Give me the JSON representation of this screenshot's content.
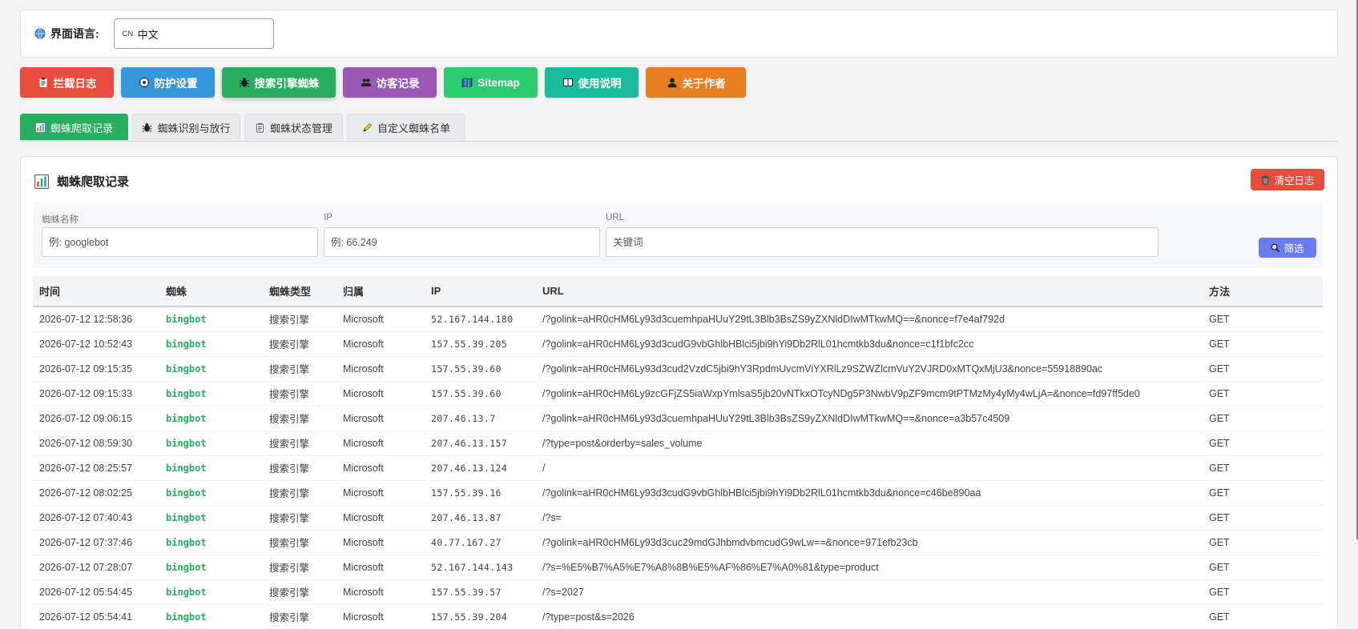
{
  "language": {
    "label": "界面语言:",
    "flag_text": "CN",
    "selected": "中文"
  },
  "main_nav": [
    {
      "label": "拦截日志",
      "icon": "clipboard-icon",
      "color": "#e74c3c"
    },
    {
      "label": "防护设置",
      "icon": "gear-icon",
      "color": "#3498db"
    },
    {
      "label": "搜索引擎蜘蛛",
      "icon": "bug-icon",
      "color": "#27ae60"
    },
    {
      "label": "访客记录",
      "icon": "users-icon",
      "color": "#9b59b6"
    },
    {
      "label": "Sitemap",
      "icon": "map-icon",
      "color": "#2ecc71"
    },
    {
      "label": "使用说明",
      "icon": "book-icon",
      "color": "#1abc9c"
    },
    {
      "label": "关于作者",
      "icon": "user-icon",
      "color": "#e67e22"
    }
  ],
  "sub_tabs": [
    {
      "label": "蜘蛛爬取记录",
      "icon": "bar-chart-icon",
      "active": true
    },
    {
      "label": "蜘蛛识别与放行",
      "icon": "bug-icon",
      "active": false
    },
    {
      "label": "蜘蛛状态管理",
      "icon": "clipboard-icon",
      "active": false
    },
    {
      "label": "自定义蜘蛛名单",
      "icon": "pencil-icon",
      "active": false
    }
  ],
  "card": {
    "title": "蜘蛛爬取记录",
    "clear_label": "清空日志"
  },
  "filters": {
    "spider_label": "蜘蛛名称",
    "spider_placeholder": "例: googlebot",
    "ip_label": "IP",
    "ip_placeholder": "例: 66.249",
    "url_label": "URL",
    "url_placeholder": "关键词",
    "button_label": "筛选"
  },
  "table": {
    "headers": [
      "时间",
      "蜘蛛",
      "蜘蛛类型",
      "归属",
      "IP",
      "URL",
      "方法"
    ],
    "rows": [
      [
        "2026-07-12 12:58:36",
        "bingbot",
        "搜索引擎",
        "Microsoft",
        "52.167.144.180",
        "/?golink=aHR0cHM6Ly93d3cuemhpaHUuY29tL3Blb3BsZS9yZXNldDIwMTkwMQ==&nonce=f7e4af792d",
        "GET"
      ],
      [
        "2026-07-12 10:52:43",
        "bingbot",
        "搜索引擎",
        "Microsoft",
        "157.55.39.205",
        "/?golink=aHR0cHM6Ly93d3cudG9vbGhlbHBlci5jbi9hYi9Db2RlL01hcmtkb3du&nonce=c1f1bfc2cc",
        "GET"
      ],
      [
        "2026-07-12 09:15:35",
        "bingbot",
        "搜索引擎",
        "Microsoft",
        "157.55.39.60",
        "/?golink=aHR0cHM6Ly93d3cud2VzdC5jbi9hY3RpdmUvcmViYXRlLz9SZWZlcmVuY2VJRD0xMTQxMjU3&nonce=55918890ac",
        "GET"
      ],
      [
        "2026-07-12 09:15:33",
        "bingbot",
        "搜索引擎",
        "Microsoft",
        "157.55.39.60",
        "/?golink=aHR0cHM6Ly9zcGFjZS5iaWxpYmlsaS5jb20vNTkxOTcyNDg5P3NwbV9pZF9mcm9tPTMzMy4yMy4wLjA=&nonce=fd97ff5de0",
        "GET"
      ],
      [
        "2026-07-12 09:06:15",
        "bingbot",
        "搜索引擎",
        "Microsoft",
        "207.46.13.7",
        "/?golink=aHR0cHM6Ly93d3cuemhpaHUuY29tL3Blb3BsZS9yZXNldDIwMTkwMQ==&nonce=a3b57c4509",
        "GET"
      ],
      [
        "2026-07-12 08:59:30",
        "bingbot",
        "搜索引擎",
        "Microsoft",
        "207.46.13.157",
        "/?type=post&orderby=sales_volume",
        "GET"
      ],
      [
        "2026-07-12 08:25:57",
        "bingbot",
        "搜索引擎",
        "Microsoft",
        "207.46.13.124",
        "/",
        "GET"
      ],
      [
        "2026-07-12 08:02:25",
        "bingbot",
        "搜索引擎",
        "Microsoft",
        "157.55.39.16",
        "/?golink=aHR0cHM6Ly93d3cudG9vbGhlbHBlci5jbi9hYi9Db2RlL01hcmtkb3du&nonce=c46be890aa",
        "GET"
      ],
      [
        "2026-07-12 07:40:43",
        "bingbot",
        "搜索引擎",
        "Microsoft",
        "207.46.13.87",
        "/?s=",
        "GET"
      ],
      [
        "2026-07-12 07:37:46",
        "bingbot",
        "搜索引擎",
        "Microsoft",
        "40.77.167.27",
        "/?golink=aHR0cHM6Ly93d3cuc29mdGJhbmdvbmcudG9wLw==&nonce=971efb23cb",
        "GET"
      ],
      [
        "2026-07-12 07:28:07",
        "bingbot",
        "搜索引擎",
        "Microsoft",
        "52.167.144.143",
        "/?s=%E5%B7%A5%E7%A8%8B%E5%AF%86%E7%A0%81&type=product",
        "GET"
      ],
      [
        "2026-07-12 05:54:45",
        "bingbot",
        "搜索引擎",
        "Microsoft",
        "157.55.39.57",
        "/?s=2027",
        "GET"
      ],
      [
        "2026-07-12 05:54:41",
        "bingbot",
        "搜索引擎",
        "Microsoft",
        "157.55.39.204",
        "/?type=post&s=2026",
        "GET"
      ]
    ]
  }
}
